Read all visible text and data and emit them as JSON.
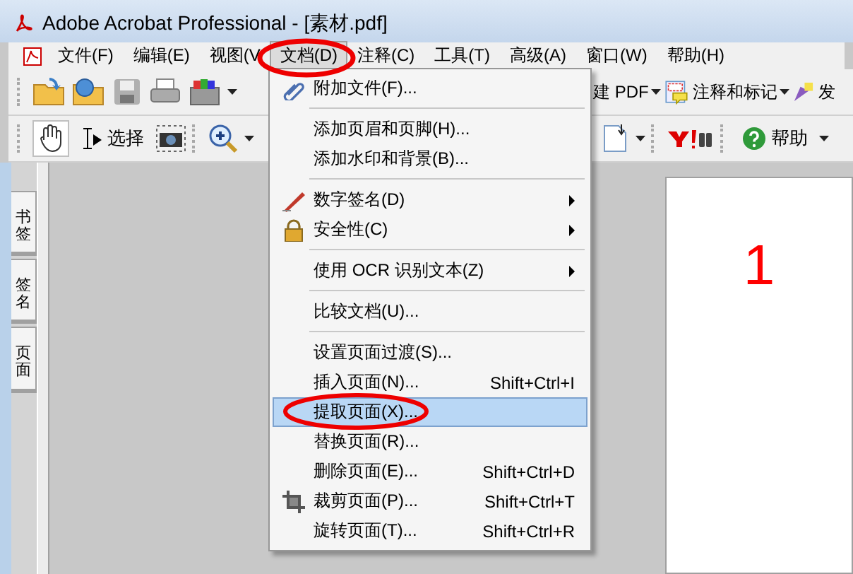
{
  "window": {
    "title": "Adobe Acrobat Professional - [素材.pdf]"
  },
  "menu_bar": [
    {
      "label": "文件(F)",
      "selected": false
    },
    {
      "label": "编辑(E)",
      "selected": false
    },
    {
      "label": "视图(V",
      "selected": false
    },
    {
      "label": "文档(D)",
      "selected": true
    },
    {
      "label": "注释(C)",
      "selected": false
    },
    {
      "label": "工具(T)",
      "selected": false
    },
    {
      "label": "高级(A)",
      "selected": false
    },
    {
      "label": "窗口(W)",
      "selected": false
    },
    {
      "label": "帮助(H)",
      "selected": false
    }
  ],
  "toolbar_top": {
    "right_labels": [
      "建 PDF",
      "注释和标记",
      "发"
    ]
  },
  "toolbar_bottom": {
    "select_label": "选择",
    "help_label": "帮助",
    "hand_pressed": true
  },
  "side_tabs": [
    {
      "label": "书签"
    },
    {
      "label": "签名"
    },
    {
      "label": "页面"
    }
  ],
  "document": {
    "page_number": "1"
  },
  "menu": {
    "items": [
      {
        "kind": "item",
        "label": "附加文件(F)...",
        "has_submenu": false,
        "selected": false
      },
      {
        "kind": "separator"
      },
      {
        "kind": "item",
        "label": "添加页眉和页脚(H)...",
        "has_submenu": false,
        "selected": false
      },
      {
        "kind": "item",
        "label": "添加水印和背景(B)...",
        "has_submenu": false,
        "selected": false
      },
      {
        "kind": "separator"
      },
      {
        "kind": "item",
        "label": "数字签名(D)",
        "has_submenu": true,
        "selected": false
      },
      {
        "kind": "item",
        "label": "安全性(C)",
        "has_submenu": true,
        "selected": false
      },
      {
        "kind": "separator"
      },
      {
        "kind": "item",
        "label": "使用 OCR 识别文本(Z)",
        "has_submenu": true,
        "selected": false
      },
      {
        "kind": "separator"
      },
      {
        "kind": "item",
        "label": "比较文档(U)...",
        "has_submenu": false,
        "selected": false
      },
      {
        "kind": "separator"
      },
      {
        "kind": "item",
        "label": "设置页面过渡(S)...",
        "has_submenu": false,
        "selected": false
      },
      {
        "kind": "item",
        "label": "插入页面(N)...",
        "shortcut": "Shift+Ctrl+I",
        "has_submenu": false,
        "selected": false
      },
      {
        "kind": "item",
        "label": "提取页面(X)...",
        "has_submenu": false,
        "selected": true
      },
      {
        "kind": "item",
        "label": "替换页面(R)...",
        "has_submenu": false,
        "selected": false
      },
      {
        "kind": "item",
        "label": "删除页面(E)...",
        "shortcut": "Shift+Ctrl+D",
        "has_submenu": false,
        "selected": false
      },
      {
        "kind": "item",
        "label": "裁剪页面(P)...",
        "shortcut": "Shift+Ctrl+T",
        "has_submenu": false,
        "selected": false
      },
      {
        "kind": "item",
        "label": "旋转页面(T)...",
        "shortcut": "Shift+Ctrl+R",
        "has_submenu": false,
        "selected": false
      }
    ]
  }
}
